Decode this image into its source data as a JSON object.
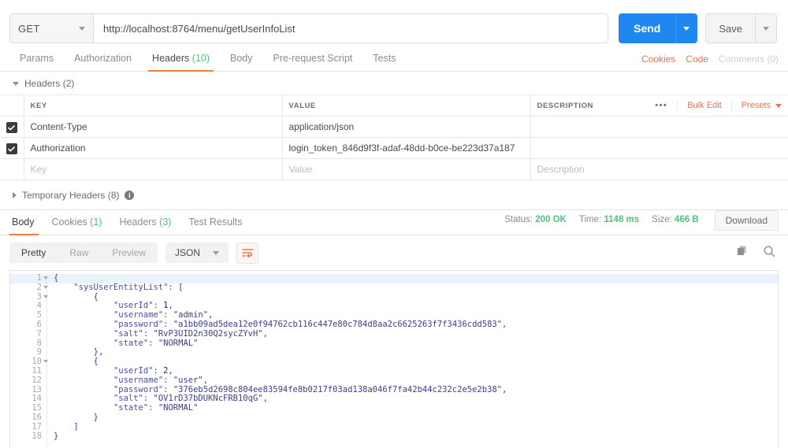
{
  "request": {
    "method": "GET",
    "url": "http://localhost:8764/menu/getUserInfoList",
    "send_label": "Send",
    "save_label": "Save"
  },
  "request_tabs": [
    {
      "label": "Params",
      "count": "",
      "active": false
    },
    {
      "label": "Authorization",
      "count": "",
      "active": false
    },
    {
      "label": "Headers",
      "count": "(10)",
      "active": true
    },
    {
      "label": "Body",
      "count": "",
      "active": false
    },
    {
      "label": "Pre-request Script",
      "count": "",
      "active": false
    },
    {
      "label": "Tests",
      "count": "",
      "active": false
    }
  ],
  "request_tabs_right": {
    "cookies": "Cookies",
    "code": "Code",
    "comments": "Comments (0)"
  },
  "headers_section": {
    "title": "Headers (2)",
    "columns": {
      "key": "KEY",
      "value": "VALUE",
      "description": "DESCRIPTION"
    },
    "actions": {
      "dots": "•••",
      "bulk_edit": "Bulk Edit",
      "presets": "Presets"
    },
    "rows": [
      {
        "checked": true,
        "key": "Content-Type",
        "value": "application/json",
        "description": ""
      },
      {
        "checked": true,
        "key": "Authorization",
        "value": "login_token_846d9f3f-adaf-48dd-b0ce-be223d37a187",
        "description": ""
      }
    ],
    "placeholder_row": {
      "key": "Key",
      "value": "Value",
      "description": "Description"
    }
  },
  "temporary_headers": {
    "label": "Temporary Headers (8)",
    "info": "i"
  },
  "response_tabs": [
    {
      "label": "Body",
      "count": "",
      "active": true
    },
    {
      "label": "Cookies",
      "count": "(1)",
      "active": false
    },
    {
      "label": "Headers",
      "count": "(3)",
      "active": false
    },
    {
      "label": "Test Results",
      "count": "",
      "active": false
    }
  ],
  "response_meta": {
    "status_label": "Status:",
    "status_value": "200 OK",
    "time_label": "Time:",
    "time_value": "1148 ms",
    "size_label": "Size:",
    "size_value": "466 B",
    "download_label": "Download"
  },
  "body_toolbar": {
    "modes": [
      {
        "label": "Pretty",
        "active": true
      },
      {
        "label": "Raw",
        "active": false
      },
      {
        "label": "Preview",
        "active": false
      }
    ],
    "format": "JSON",
    "wrap_icon": "wrap-lines-icon",
    "copy_icon": "copy-icon",
    "search_icon": "search-icon"
  },
  "response_body": {
    "lines": [
      {
        "n": "1",
        "fold": true,
        "text": "{",
        "indent": 0
      },
      {
        "n": "2",
        "fold": true,
        "text": "    \"sysUserEntityList\": [",
        "indent": 0
      },
      {
        "n": "3",
        "fold": true,
        "text": "        {",
        "indent": 0
      },
      {
        "n": "4",
        "fold": false,
        "text": "            \"userId\": 1,",
        "indent": 0
      },
      {
        "n": "5",
        "fold": false,
        "text": "            \"username\": \"admin\",",
        "indent": 0
      },
      {
        "n": "6",
        "fold": false,
        "text": "            \"password\": \"a1bb09ad5dea12e0f94762cb116c447e80c784d8aa2c6625263f7f3436cdd583\",",
        "indent": 0
      },
      {
        "n": "7",
        "fold": false,
        "text": "            \"salt\": \"RvP3UID2n30Q2sycZYvH\",",
        "indent": 0
      },
      {
        "n": "8",
        "fold": false,
        "text": "            \"state\": \"NORMAL\"",
        "indent": 0
      },
      {
        "n": "9",
        "fold": false,
        "text": "        },",
        "indent": 0
      },
      {
        "n": "10",
        "fold": true,
        "text": "        {",
        "indent": 0
      },
      {
        "n": "11",
        "fold": false,
        "text": "            \"userId\": 2,",
        "indent": 0
      },
      {
        "n": "12",
        "fold": false,
        "text": "            \"username\": \"user\",",
        "indent": 0
      },
      {
        "n": "13",
        "fold": false,
        "text": "            \"password\": \"376eb5d2698c804ee83594fe8b0217f03ad138a046f7fa42b44c232c2e5e2b38\",",
        "indent": 0
      },
      {
        "n": "14",
        "fold": false,
        "text": "            \"salt\": \"OV1rD37bDUKNcFRB10qG\",",
        "indent": 0
      },
      {
        "n": "15",
        "fold": false,
        "text": "            \"state\": \"NORMAL\"",
        "indent": 0
      },
      {
        "n": "16",
        "fold": false,
        "text": "        }",
        "indent": 0
      },
      {
        "n": "17",
        "fold": false,
        "text": "    ]",
        "indent": 0
      },
      {
        "n": "18",
        "fold": false,
        "text": "}",
        "indent": 0
      }
    ]
  },
  "colors": {
    "accent": "#ef7d44",
    "send_blue": "#1e87f0",
    "success_green": "#4cc47c",
    "orange_link": "#e8734a"
  }
}
